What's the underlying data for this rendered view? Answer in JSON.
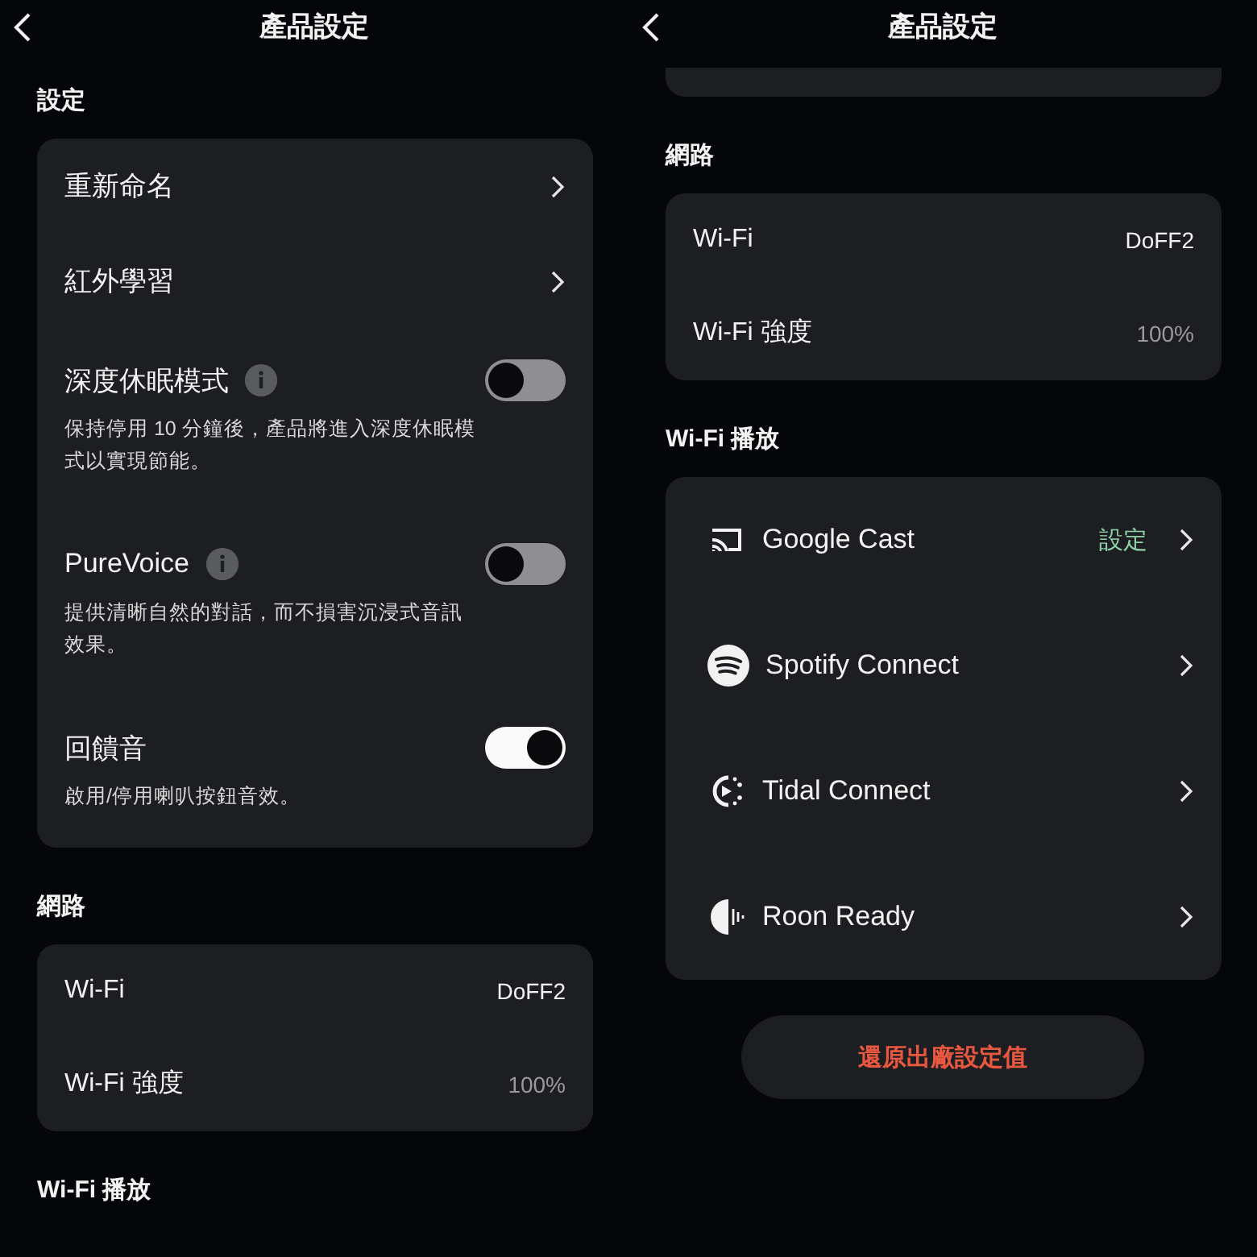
{
  "screens": [
    {
      "header": {
        "title": "產品設定"
      },
      "top_card_cut": false,
      "sections": [
        {
          "heading": "設定",
          "items": [
            {
              "kind": "link",
              "label": "重新命名"
            },
            {
              "kind": "link",
              "label": "紅外學習"
            },
            {
              "kind": "toggle",
              "label": "深度休眠模式",
              "has_info": true,
              "on": false,
              "description": "保持停用 10 分鐘後，產品將進入深度休眠模式以實現節能。"
            },
            {
              "kind": "toggle",
              "label": "PureVoice",
              "has_info": true,
              "on": false,
              "description": "提供清晰自然的對話，而不損害沉浸式音訊效果。"
            },
            {
              "kind": "toggle",
              "label": "回饋音",
              "has_info": false,
              "on": true,
              "description": "啟用/停用喇叭按鈕音效。"
            }
          ]
        },
        {
          "heading": "網路",
          "items": [
            {
              "kind": "info",
              "label": "Wi-Fi",
              "value": "DoFF2",
              "dim": false
            },
            {
              "kind": "info",
              "label": "Wi-Fi 強度",
              "value": "100%",
              "dim": true
            }
          ]
        },
        {
          "heading": "Wi-Fi 播放"
        }
      ]
    },
    {
      "header": {
        "title": "產品設定"
      },
      "top_card_cut": true,
      "sections": [
        {
          "heading": "網路",
          "items": [
            {
              "kind": "info",
              "label": "Wi-Fi",
              "value": "DoFF2",
              "dim": false
            },
            {
              "kind": "info",
              "label": "Wi-Fi 強度",
              "value": "100%",
              "dim": true
            }
          ]
        },
        {
          "heading": "Wi-Fi 播放",
          "items": [
            {
              "kind": "service",
              "label": "Google Cast",
              "status": "設定"
            },
            {
              "kind": "service",
              "label": "Spotify Connect"
            },
            {
              "kind": "service",
              "label": "Tidal Connect"
            },
            {
              "kind": "service",
              "label": "Roon Ready"
            }
          ]
        }
      ],
      "reset_button": "還原出廠設定值"
    }
  ]
}
